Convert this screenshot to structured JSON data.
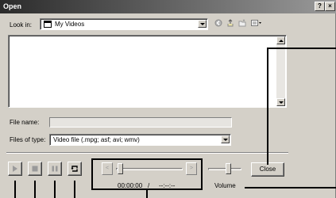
{
  "window": {
    "title": "Open",
    "help_label": "?",
    "close_label": "×"
  },
  "look_in": {
    "label": "Look in:",
    "value": "My Videos"
  },
  "toolbar_icons": [
    "back-icon",
    "up-folder-icon",
    "new-folder-icon",
    "views-menu-icon"
  ],
  "file_name": {
    "label": "File name:",
    "value": ""
  },
  "files_of_type": {
    "label": "Files of type:",
    "value": "Video file (.mpg; asf; avi; wmv)"
  },
  "player": {
    "buttons": [
      "play-icon",
      "stop-icon",
      "pause-icon",
      "loop-icon"
    ],
    "seek_back_label": "<",
    "seek_forward_label": ">",
    "seek_position": 0,
    "time_current": "00:00:00",
    "time_separator": "/",
    "time_total": "--:--:--",
    "volume_label": "Volume",
    "close_label": "Close"
  }
}
